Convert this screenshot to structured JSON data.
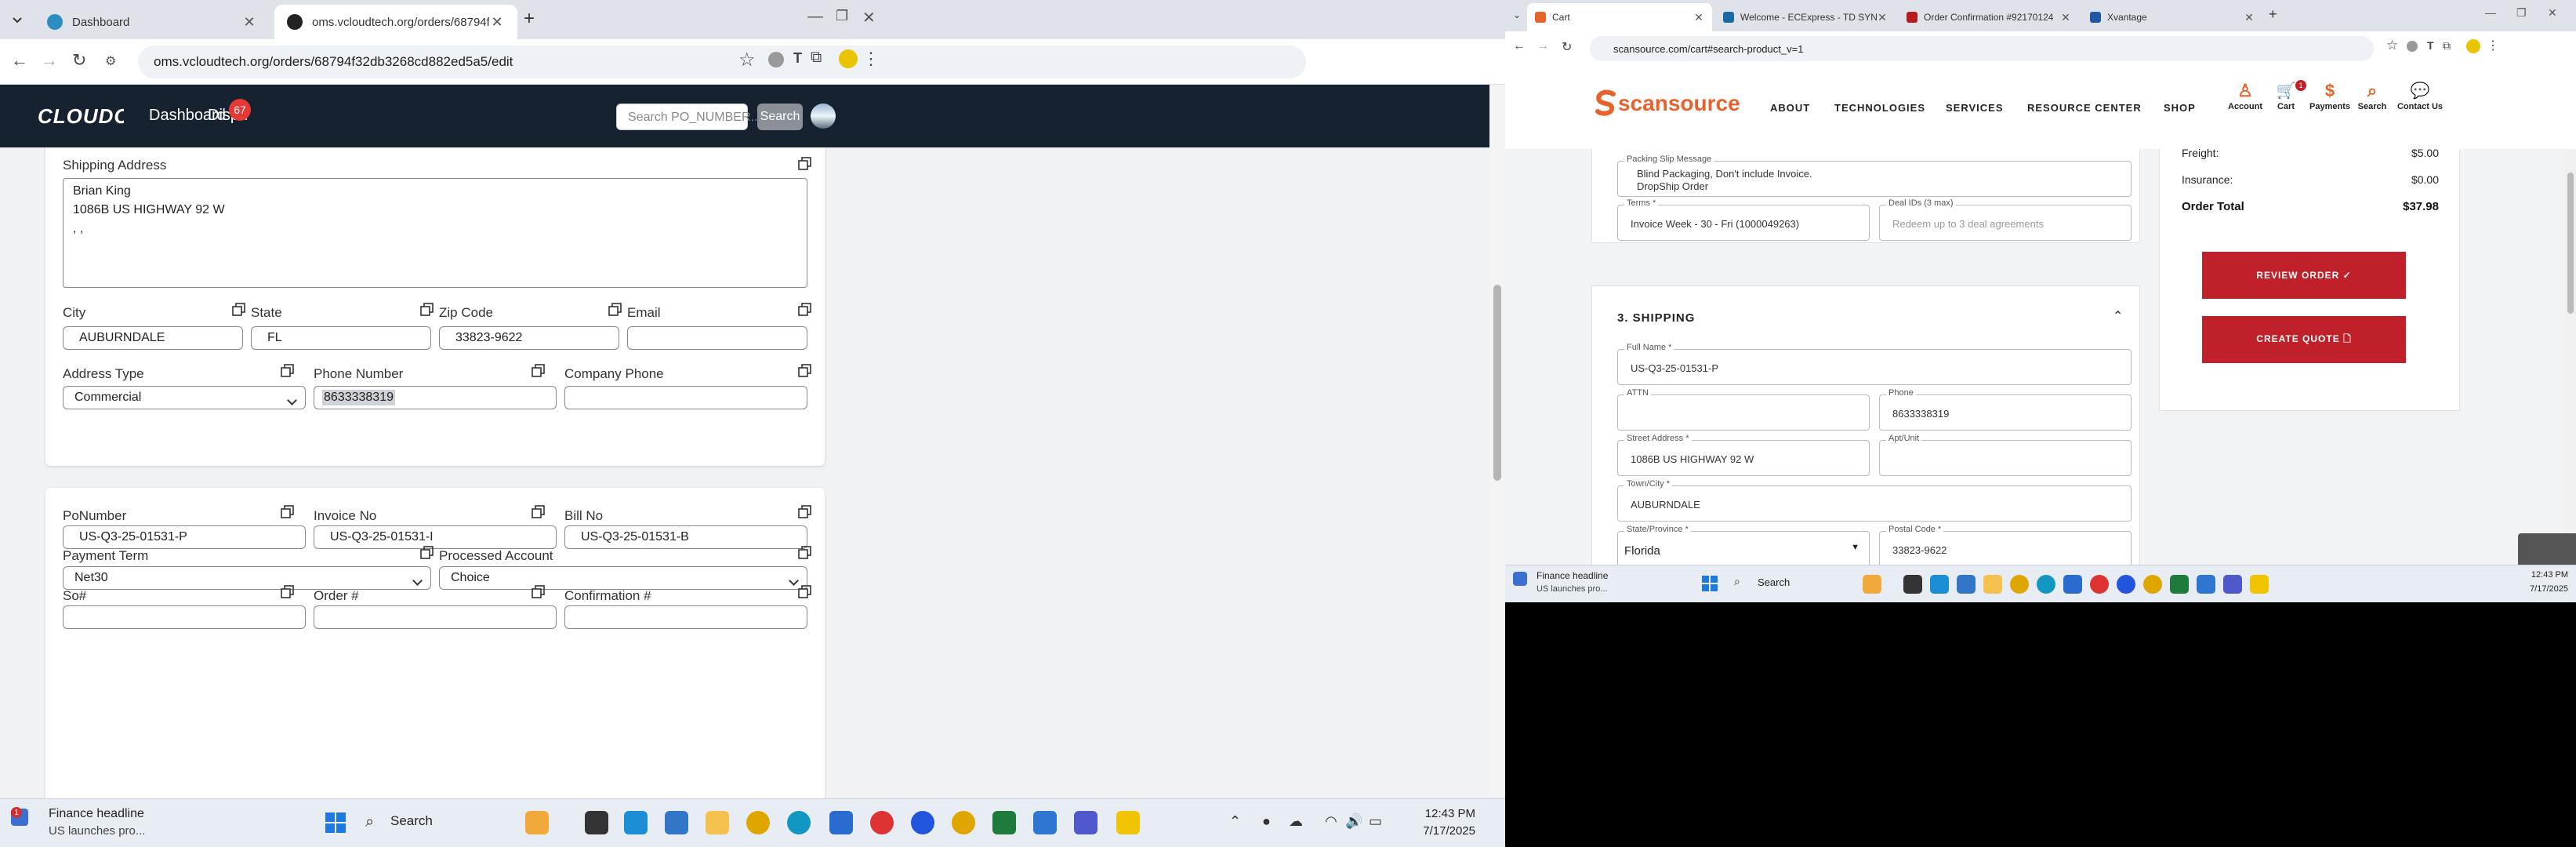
{
  "left_browser": {
    "tabs": [
      {
        "title": "Dashboard"
      },
      {
        "title": "oms.vcloudtech.org/orders/68794f"
      }
    ],
    "url": "oms.vcloudtech.org/orders/68794f32db3268cd882ed5a5/edit",
    "nav": {
      "logo": "CLOUDCHOICE",
      "links": [
        "Dashboard",
        "Dispu"
      ],
      "badge": "67",
      "search_placeholder": "Search PO_NUMBER...",
      "search_button": "Search"
    },
    "shipping_card": {
      "shipping_address_label": "Shipping Address",
      "shipping_address_lines": [
        "Brian King",
        "1086B US HIGHWAY 92 W",
        ", ,"
      ],
      "city_label": "City",
      "city_value": "AUBURNDALE",
      "state_label": "State",
      "state_value": "FL",
      "zip_label": "Zip Code",
      "zip_value": "33823-9622",
      "email_label": "Email",
      "email_value": "",
      "address_type_label": "Address Type",
      "address_type_value": "Commercial",
      "phone_label": "Phone Number",
      "phone_value": "8633338319",
      "company_phone_label": "Company Phone",
      "company_phone_value": ""
    },
    "order_card": {
      "po_label": "PoNumber",
      "po_value": "US-Q3-25-01531-P",
      "invoice_label": "Invoice No",
      "invoice_value": "US-Q3-25-01531-I",
      "bill_label": "Bill No",
      "bill_value": "US-Q3-25-01531-B",
      "payment_term_label": "Payment Term",
      "payment_term_value": "Net30",
      "processed_account_label": "Processed Account",
      "processed_account_value": "Choice",
      "so_label": "So#",
      "order_label": "Order #",
      "confirmation_label": "Confirmation #"
    },
    "taskbar": {
      "news_title": "Finance headline",
      "news_sub": "US launches pro...",
      "news_badge": "1",
      "search": "Search",
      "time": "12:43 PM",
      "date": "7/17/2025"
    }
  },
  "right_browser": {
    "tabs": [
      {
        "title": "Cart"
      },
      {
        "title": "Welcome - ECExpress - TD SYNN"
      },
      {
        "title": "Order Confirmation #92170124"
      },
      {
        "title": "Xvantage"
      }
    ],
    "url": "scansource.com/cart#search-product_v=1",
    "header": {
      "logo": "scansource",
      "nav": [
        "ABOUT",
        "TECHNOLOGIES",
        "SERVICES",
        "RESOURCE CENTER",
        "SHOP"
      ],
      "icons": [
        "Account",
        "Cart",
        "Payments",
        "Search",
        "Contact Us"
      ],
      "cart_count": "1"
    },
    "order_top": {
      "packing_slip_label": "Packing Slip Message",
      "packing_slip_lines": [
        "Blind Packaging, Don't include Invoice.",
        "DropShip Order"
      ],
      "terms_label": "Terms *",
      "terms_value": "Invoice Week - 30 - Fri (1000049263)",
      "deal_label": "Deal IDs (3 max)",
      "deal_placeholder": "Redeem up to 3 deal agreements"
    },
    "shipping": {
      "section_title": "3. SHIPPING",
      "full_name_label": "Full Name *",
      "full_name_value": "US-Q3-25-01531-P",
      "attn_label": "ATTN",
      "attn_value": "",
      "phone_label": "Phone",
      "phone_value": "8633338319",
      "street_label": "Street Address *",
      "street_value": "1086B US HIGHWAY 92 W",
      "apt_label": "Apt/Unit",
      "apt_value": "",
      "town_label": "Town/City *",
      "town_value": "AUBURNDALE",
      "state_label": "State/Province *",
      "state_value": "Florida",
      "postal_label": "Postal Code *",
      "postal_value": "33823-9622"
    },
    "summary": {
      "freight_label": "Freight:",
      "freight_value": "$5.00",
      "insurance_label": "Insurance:",
      "insurance_value": "$0.00",
      "total_label": "Order Total",
      "total_value": "$37.98",
      "review_button": "REVIEW ORDER ✓",
      "quote_button": "CREATE QUOTE 🗋"
    },
    "taskbar": {
      "news_title": "Finance headline",
      "news_sub": "US launches pro...",
      "search": "Search",
      "time": "12:43 PM",
      "date": "7/17/2025"
    }
  },
  "colors": {
    "nav_bg": "#172230",
    "brand_red": "#c0202a",
    "badge_red": "#e53935",
    "scansource_orange": "#e8632b"
  }
}
